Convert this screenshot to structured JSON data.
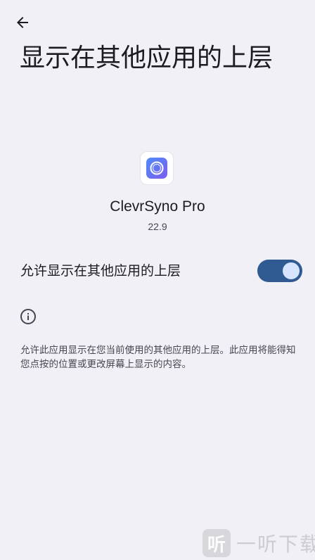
{
  "header": {
    "back_icon": "arrow-left-icon",
    "title": "显示在其他应用的上层"
  },
  "app": {
    "name": "ClevrSyno Pro",
    "version": "22.9",
    "icon": "app-ring-icon",
    "icon_colors": [
      "#4f8df7",
      "#7b5cf0"
    ]
  },
  "permission": {
    "label": "允许显示在其他应用的上层",
    "enabled": true,
    "accent_color": "#2f5b92"
  },
  "info": {
    "icon": "info-icon",
    "description": "允许此应用显示在您当前使用的其他应用的上层。此应用将能得知您点按的位置或更改屏幕上显示的内容。"
  },
  "watermark": {
    "logo_text": "听",
    "text": "一听下载"
  }
}
